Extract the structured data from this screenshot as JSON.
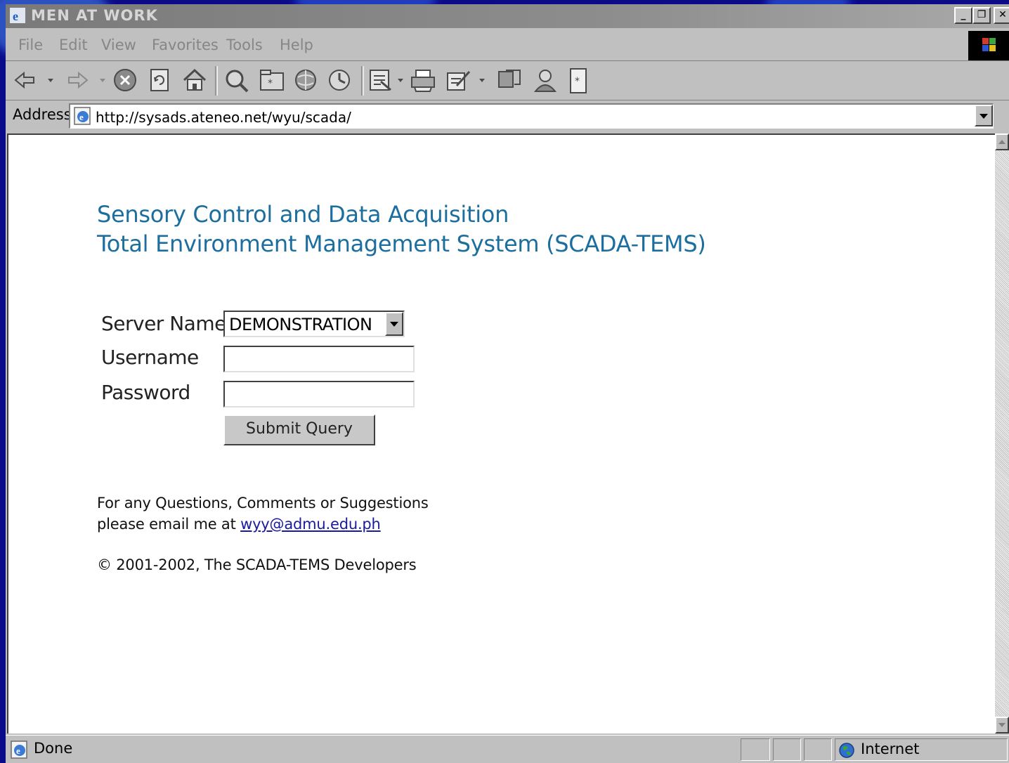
{
  "window": {
    "title": "MEN AT WORK",
    "minimize_glyph": "_",
    "maximize_glyph": "❐",
    "close_glyph": "✕"
  },
  "menu": {
    "items": [
      "File",
      "Edit",
      "View",
      "Favorites",
      "Tools",
      "Help"
    ]
  },
  "toolbar": {
    "icons": [
      "back-icon",
      "forward-icon",
      "stop-icon",
      "refresh-icon",
      "home-icon",
      "search-icon",
      "favorites-icon",
      "channels-icon",
      "history-icon",
      "mail-icon",
      "print-icon",
      "edit-icon",
      "discuss-icon",
      "messenger-icon",
      "calculator-icon"
    ]
  },
  "address": {
    "label": "Address",
    "url": "http://sysads.ateneo.net/wyu/scada/"
  },
  "page": {
    "heading_line1": "Sensory Control and Data Acquisition",
    "heading_line2": "Total Environment Management System (SCADA-TEMS)",
    "heading_color": "#1c6e9e",
    "server_label": "Server Name",
    "server_value": "DEMONSTRATION",
    "username_label": "Username",
    "username_value": "",
    "password_label": "Password",
    "password_value": "",
    "submit_label": "Submit Query",
    "contact_line1": "For any Questions, Comments or Suggestions",
    "contact_line2_prefix": "please email me at ",
    "contact_email": "wyy@admu.edu.ph",
    "copyright": "© 2001-2002, The SCADA-TEMS Developers"
  },
  "status": {
    "text": "Done",
    "zone": "Internet"
  }
}
